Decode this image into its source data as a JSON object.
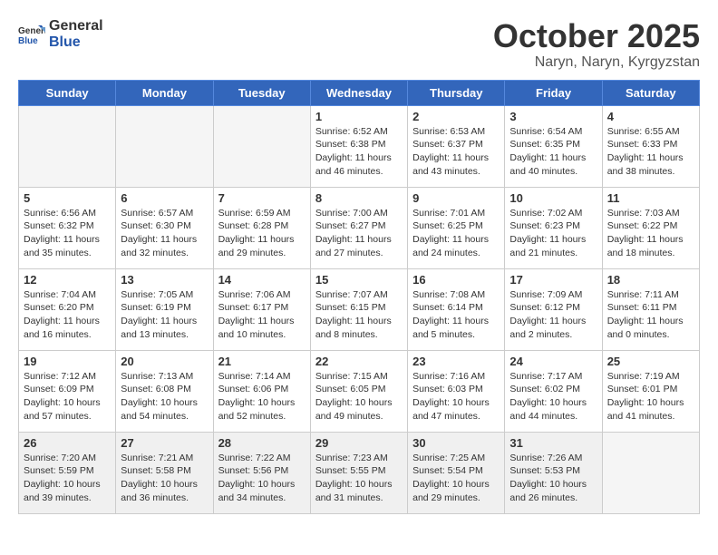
{
  "logo": {
    "general": "General",
    "blue": "Blue"
  },
  "title": "October 2025",
  "location": "Naryn, Naryn, Kyrgyzstan",
  "headers": [
    "Sunday",
    "Monday",
    "Tuesday",
    "Wednesday",
    "Thursday",
    "Friday",
    "Saturday"
  ],
  "weeks": [
    [
      {
        "day": "",
        "text": ""
      },
      {
        "day": "",
        "text": ""
      },
      {
        "day": "",
        "text": ""
      },
      {
        "day": "1",
        "text": "Sunrise: 6:52 AM\nSunset: 6:38 PM\nDaylight: 11 hours\nand 46 minutes."
      },
      {
        "day": "2",
        "text": "Sunrise: 6:53 AM\nSunset: 6:37 PM\nDaylight: 11 hours\nand 43 minutes."
      },
      {
        "day": "3",
        "text": "Sunrise: 6:54 AM\nSunset: 6:35 PM\nDaylight: 11 hours\nand 40 minutes."
      },
      {
        "day": "4",
        "text": "Sunrise: 6:55 AM\nSunset: 6:33 PM\nDaylight: 11 hours\nand 38 minutes."
      }
    ],
    [
      {
        "day": "5",
        "text": "Sunrise: 6:56 AM\nSunset: 6:32 PM\nDaylight: 11 hours\nand 35 minutes."
      },
      {
        "day": "6",
        "text": "Sunrise: 6:57 AM\nSunset: 6:30 PM\nDaylight: 11 hours\nand 32 minutes."
      },
      {
        "day": "7",
        "text": "Sunrise: 6:59 AM\nSunset: 6:28 PM\nDaylight: 11 hours\nand 29 minutes."
      },
      {
        "day": "8",
        "text": "Sunrise: 7:00 AM\nSunset: 6:27 PM\nDaylight: 11 hours\nand 27 minutes."
      },
      {
        "day": "9",
        "text": "Sunrise: 7:01 AM\nSunset: 6:25 PM\nDaylight: 11 hours\nand 24 minutes."
      },
      {
        "day": "10",
        "text": "Sunrise: 7:02 AM\nSunset: 6:23 PM\nDaylight: 11 hours\nand 21 minutes."
      },
      {
        "day": "11",
        "text": "Sunrise: 7:03 AM\nSunset: 6:22 PM\nDaylight: 11 hours\nand 18 minutes."
      }
    ],
    [
      {
        "day": "12",
        "text": "Sunrise: 7:04 AM\nSunset: 6:20 PM\nDaylight: 11 hours\nand 16 minutes."
      },
      {
        "day": "13",
        "text": "Sunrise: 7:05 AM\nSunset: 6:19 PM\nDaylight: 11 hours\nand 13 minutes."
      },
      {
        "day": "14",
        "text": "Sunrise: 7:06 AM\nSunset: 6:17 PM\nDaylight: 11 hours\nand 10 minutes."
      },
      {
        "day": "15",
        "text": "Sunrise: 7:07 AM\nSunset: 6:15 PM\nDaylight: 11 hours\nand 8 minutes."
      },
      {
        "day": "16",
        "text": "Sunrise: 7:08 AM\nSunset: 6:14 PM\nDaylight: 11 hours\nand 5 minutes."
      },
      {
        "day": "17",
        "text": "Sunrise: 7:09 AM\nSunset: 6:12 PM\nDaylight: 11 hours\nand 2 minutes."
      },
      {
        "day": "18",
        "text": "Sunrise: 7:11 AM\nSunset: 6:11 PM\nDaylight: 11 hours\nand 0 minutes."
      }
    ],
    [
      {
        "day": "19",
        "text": "Sunrise: 7:12 AM\nSunset: 6:09 PM\nDaylight: 10 hours\nand 57 minutes."
      },
      {
        "day": "20",
        "text": "Sunrise: 7:13 AM\nSunset: 6:08 PM\nDaylight: 10 hours\nand 54 minutes."
      },
      {
        "day": "21",
        "text": "Sunrise: 7:14 AM\nSunset: 6:06 PM\nDaylight: 10 hours\nand 52 minutes."
      },
      {
        "day": "22",
        "text": "Sunrise: 7:15 AM\nSunset: 6:05 PM\nDaylight: 10 hours\nand 49 minutes."
      },
      {
        "day": "23",
        "text": "Sunrise: 7:16 AM\nSunset: 6:03 PM\nDaylight: 10 hours\nand 47 minutes."
      },
      {
        "day": "24",
        "text": "Sunrise: 7:17 AM\nSunset: 6:02 PM\nDaylight: 10 hours\nand 44 minutes."
      },
      {
        "day": "25",
        "text": "Sunrise: 7:19 AM\nSunset: 6:01 PM\nDaylight: 10 hours\nand 41 minutes."
      }
    ],
    [
      {
        "day": "26",
        "text": "Sunrise: 7:20 AM\nSunset: 5:59 PM\nDaylight: 10 hours\nand 39 minutes."
      },
      {
        "day": "27",
        "text": "Sunrise: 7:21 AM\nSunset: 5:58 PM\nDaylight: 10 hours\nand 36 minutes."
      },
      {
        "day": "28",
        "text": "Sunrise: 7:22 AM\nSunset: 5:56 PM\nDaylight: 10 hours\nand 34 minutes."
      },
      {
        "day": "29",
        "text": "Sunrise: 7:23 AM\nSunset: 5:55 PM\nDaylight: 10 hours\nand 31 minutes."
      },
      {
        "day": "30",
        "text": "Sunrise: 7:25 AM\nSunset: 5:54 PM\nDaylight: 10 hours\nand 29 minutes."
      },
      {
        "day": "31",
        "text": "Sunrise: 7:26 AM\nSunset: 5:53 PM\nDaylight: 10 hours\nand 26 minutes."
      },
      {
        "day": "",
        "text": ""
      }
    ]
  ]
}
